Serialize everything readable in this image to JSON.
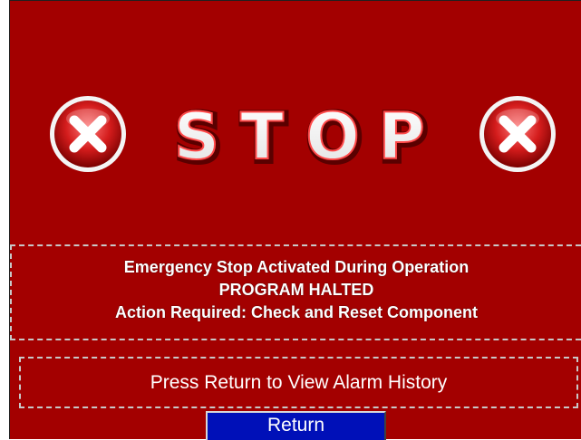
{
  "banner": {
    "word": "STOP",
    "letters": [
      "S",
      "T",
      "O",
      "P"
    ],
    "left_icon": "close-x-icon",
    "right_icon": "close-x-icon"
  },
  "alarm_message": {
    "line1": "Emergency Stop Activated During Operation",
    "line2": "PROGRAM HALTED",
    "line3": "Action Required:  Check and Reset Component"
  },
  "history_prompt": "Press Return to View Alarm History",
  "return_button_label": "Return",
  "colors": {
    "panel_background": "#a30000",
    "button_background": "#0010b8",
    "text": "#ffffff",
    "dashed_border": "#c8c8c8"
  }
}
